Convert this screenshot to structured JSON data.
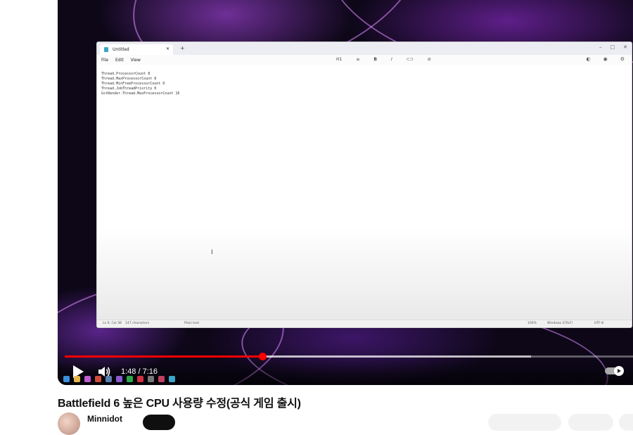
{
  "video": {
    "title": "Battlefield 6 높은 CPU 사용량 수정(공식 게임 출시)",
    "time_display": "1:48 / 7:16",
    "progress_played": 0.348,
    "progress_buffered": 0.82,
    "autoplay_on": true,
    "accent_color": "#ff0000"
  },
  "channel": {
    "name": "Minnidot"
  },
  "notepad": {
    "tab_title": "Untitled",
    "menu": [
      "File",
      "Edit",
      "View"
    ],
    "format_controls": [
      "H1",
      "≡",
      "B",
      "I",
      "⊂⊃",
      "⊘"
    ],
    "content": "Thread.ProcessorCount 8\nThread.MaxProcessorCount 8\nThread.MinFreeProcessorCount 0\nThread.JobThreadPriority 0\nGstRender.Thread.MaxProcessorCount 16",
    "status": {
      "position": "Ln 6, Col 38",
      "characters": "147 characters",
      "format": "Plain text",
      "zoom": "100%",
      "line_ending": "Windows (CRLF)",
      "encoding": "UTF-8"
    }
  },
  "icons": [
    "play-icon",
    "volume-icon",
    "autoplay-toggle-icon",
    "notepad-icon",
    "close-icon",
    "plus-icon",
    "minimize-icon",
    "maximize-icon",
    "settings-icon",
    "text-cursor-icon"
  ]
}
